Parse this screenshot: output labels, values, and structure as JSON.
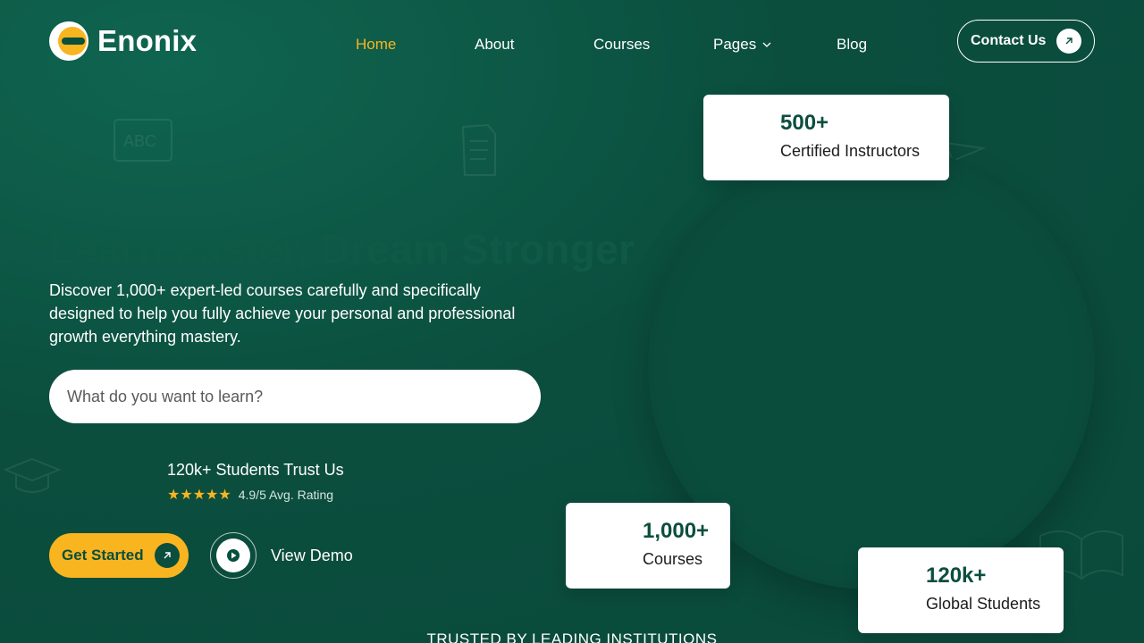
{
  "brand": {
    "name": "Enonix"
  },
  "nav": {
    "items": [
      {
        "label": "Home",
        "active": true
      },
      {
        "label": "About"
      },
      {
        "label": "Courses"
      },
      {
        "label": "Pages",
        "has_dropdown": true
      },
      {
        "label": "Blog"
      }
    ],
    "contact_label": "Contact Us"
  },
  "hero": {
    "title": "Learn Faster, Dream Stronger",
    "description": "Discover 1,000+ expert-led courses carefully and specifically designed to help you fully achieve your personal and professional growth everything mastery.",
    "search_placeholder": "What do you want to learn?",
    "trust_title": "120k+ Students Trust Us",
    "stars": "★★★★★",
    "rating_text": "4.9/5 Avg. Rating",
    "cta_label": "Get Started",
    "demo_label": "View Demo"
  },
  "stats": [
    {
      "value": "500+",
      "label": "Certified Instructors"
    },
    {
      "value": "1,000+",
      "label": "Courses"
    },
    {
      "value": "120k+",
      "label": "Global Students"
    }
  ],
  "trusted_heading": "TRUSTED BY LEADING INSTITUTIONS",
  "colors": {
    "accent": "#f9b51f",
    "background": "#0b4e3e",
    "white": "#ffffff"
  },
  "icons": [
    "logo-icon",
    "chevron-down-icon",
    "arrow-up-right-icon",
    "play-icon",
    "star-icon"
  ]
}
